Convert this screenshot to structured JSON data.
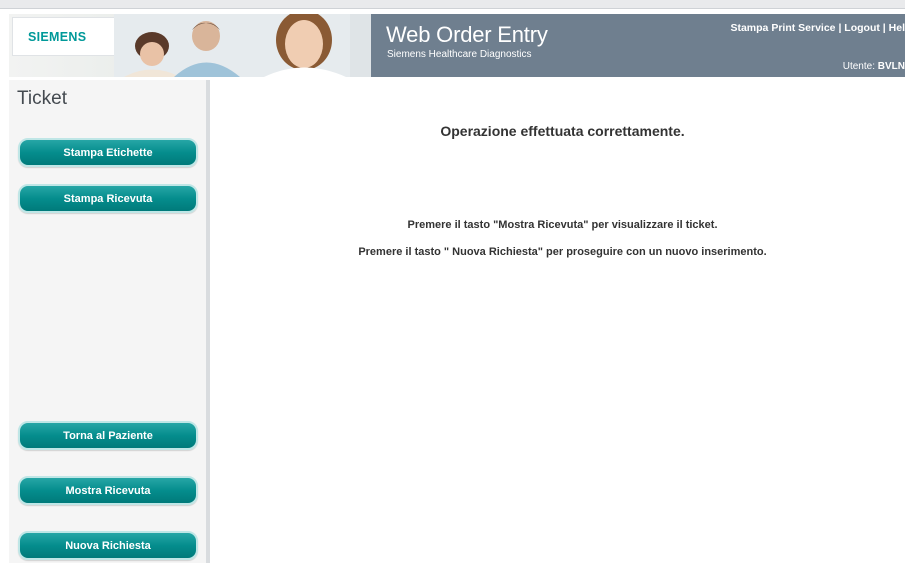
{
  "header": {
    "brand": "SIEMENS",
    "title": "Web Order Entry",
    "subtitle": "Siemens Healthcare Diagnostics",
    "links": [
      "Stampa Print Service",
      "Logout",
      "Hel"
    ],
    "user_label": "Utente:",
    "user_value": "BVLN"
  },
  "sidebar": {
    "title": "Ticket",
    "buttons": [
      "Stampa Etichette",
      "Stampa Ricevuta",
      "Torna al Paziente",
      "Mostra Ricevuta",
      "Nuova Richiesta"
    ]
  },
  "main": {
    "message_title": "Operazione effettuata correttamente.",
    "message_lines": [
      "Premere il tasto \"Mostra Ricevuta\" per visualizzare il ticket.",
      "Premere il tasto \" Nuova Richiesta\" per proseguire con un nuovo inserimento."
    ]
  },
  "colors": {
    "header_bar": "#6f7f8f",
    "button_teal": "#058d8d",
    "brand": "#009999"
  }
}
